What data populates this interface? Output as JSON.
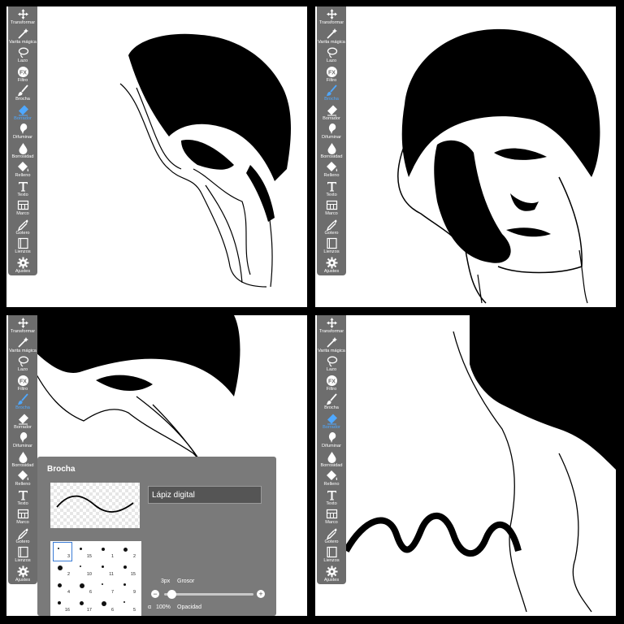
{
  "tools_full": [
    {
      "label": "Transformar",
      "icon": "move-icon"
    },
    {
      "label": "Varita mágica",
      "icon": "magic-wand-icon"
    },
    {
      "label": "Lazo",
      "icon": "lasso-icon"
    },
    {
      "label": "Filtro",
      "icon": "fx-icon"
    },
    {
      "label": "Brocha",
      "icon": "brush-icon"
    },
    {
      "label": "Borrador",
      "icon": "eraser-icon"
    },
    {
      "label": "Difuminar",
      "icon": "smudge-icon"
    },
    {
      "label": "Borrosidad",
      "icon": "blur-drop-icon"
    },
    {
      "label": "Relleno",
      "icon": "fill-bucket-icon"
    },
    {
      "label": "Texto",
      "icon": "text-icon"
    },
    {
      "label": "Marco",
      "icon": "frame-icon"
    },
    {
      "label": "Gotero",
      "icon": "eyedropper-icon"
    },
    {
      "label": "Lienzos",
      "icon": "canvases-icon"
    },
    {
      "label": "Ajustes",
      "icon": "gear-icon"
    }
  ],
  "panels": [
    {
      "active_tool": "Borrador"
    },
    {
      "active_tool": "Brocha"
    },
    {
      "active_tool": "Brocha"
    },
    {
      "active_tool": "Borrador"
    }
  ],
  "brush_popup": {
    "title": "Brocha",
    "brush_name": "Lápiz digital",
    "size_value": "3px",
    "size_label": "Grosor",
    "opacity_value": "100%",
    "opacity_label": "Opacidad",
    "alpha_symbol": "α",
    "minus": "−",
    "plus": "+",
    "grid_numbers": [
      "3",
      "15",
      "1",
      "2",
      "2",
      "10",
      "11",
      "15",
      "4",
      "6",
      "7",
      "9",
      "16",
      "17",
      "6",
      "5"
    ]
  },
  "colors": {
    "accent": "#4fa8ff",
    "toolbar": "#6d6d6d",
    "popup": "#7a7a7a",
    "ink": "#000000"
  }
}
